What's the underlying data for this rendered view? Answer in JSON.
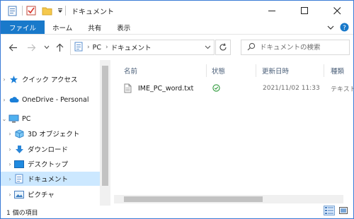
{
  "window": {
    "title": "ドキュメント",
    "accent": "#1979ca"
  },
  "ribbon": {
    "tabs": [
      "ファイル",
      "ホーム",
      "共有",
      "表示"
    ]
  },
  "address": {
    "segments": [
      "PC",
      "ドキュメント"
    ],
    "search_placeholder": "ドキュメントの検索"
  },
  "nav": {
    "items": [
      {
        "label": "クイック アクセス",
        "icon": "star-icon"
      },
      {
        "label": "OneDrive - Personal",
        "icon": "cloud-icon"
      },
      {
        "label": "PC",
        "icon": "computer-icon"
      },
      {
        "label": "3D オブジェクト",
        "icon": "cube-icon"
      },
      {
        "label": "ダウンロード",
        "icon": "download-icon"
      },
      {
        "label": "デスクトップ",
        "icon": "desktop-icon"
      },
      {
        "label": "ドキュメント",
        "icon": "document-icon"
      },
      {
        "label": "ピクチャ",
        "icon": "pictures-icon"
      }
    ]
  },
  "columns": [
    "名前",
    "状態",
    "更新日時",
    "種類"
  ],
  "files": [
    {
      "name": "IME_PC_word.txt",
      "status": "synced",
      "modified": "2021/11/02 11:33",
      "type": "テキスト"
    }
  ],
  "status": {
    "item_count": "1 個の項目"
  }
}
